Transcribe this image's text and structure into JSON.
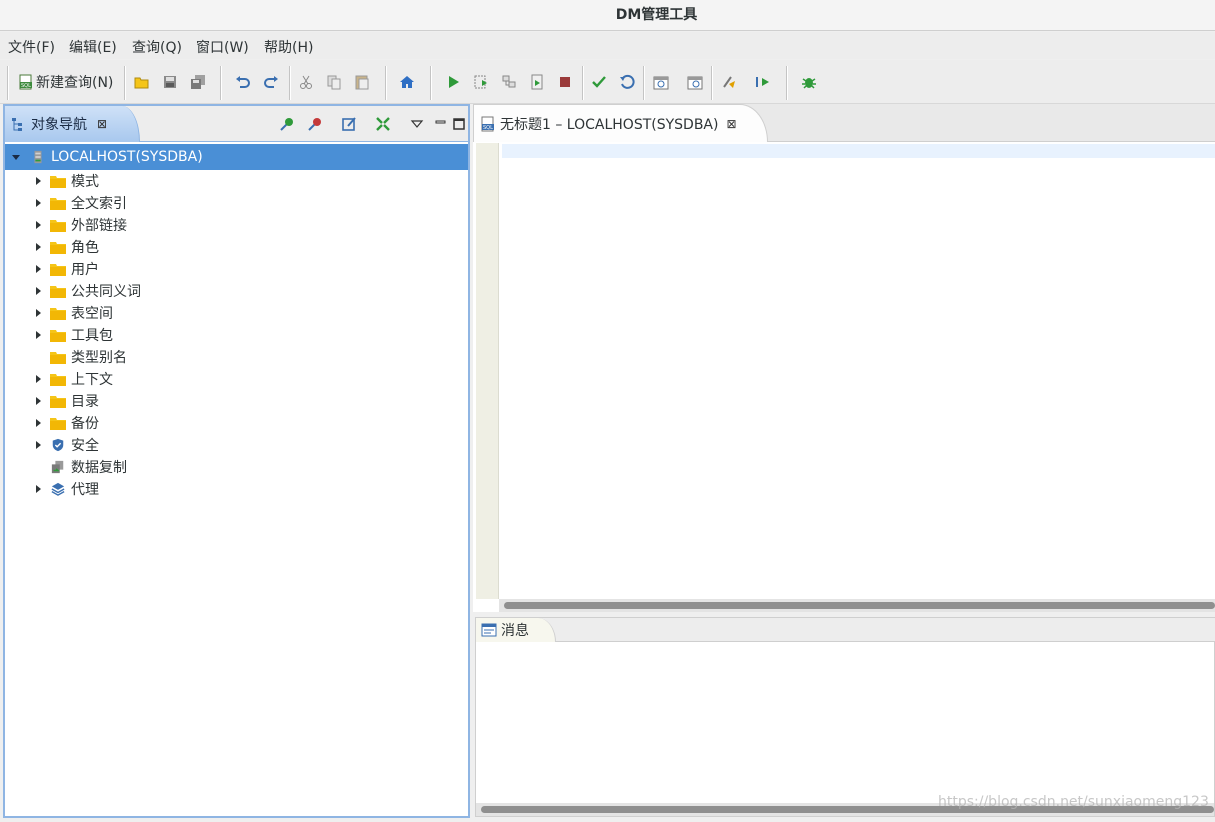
{
  "window": {
    "title": "DM管理工具"
  },
  "menubar": {
    "items": [
      "文件(F)",
      "编辑(E)",
      "查询(Q)",
      "窗口(W)",
      "帮助(H)"
    ]
  },
  "toolbar": {
    "new_query_label": "新建查询(N)",
    "icons": [
      "open-icon",
      "save-icon",
      "save-all-icon",
      "undo-icon",
      "redo-icon",
      "cut-icon",
      "copy-icon",
      "paste-icon",
      "home-icon",
      "run-icon",
      "run-selection-icon",
      "explain-icon",
      "run-script-icon",
      "stop-icon",
      "commit-icon",
      "rollback-icon",
      "schedule-icon",
      "schedule-alt-icon",
      "format-icon",
      "step-icon",
      "debug-icon"
    ]
  },
  "navigator": {
    "tab_label": "对象导航",
    "close_glyph": "⊠",
    "root": "LOCALHOST(SYSDBA)",
    "items": [
      {
        "label": "模式",
        "expandable": true,
        "icon": "folder-icon"
      },
      {
        "label": "全文索引",
        "expandable": true,
        "icon": "folder-icon"
      },
      {
        "label": "外部链接",
        "expandable": true,
        "icon": "folder-icon"
      },
      {
        "label": "角色",
        "expandable": true,
        "icon": "folder-icon"
      },
      {
        "label": "用户",
        "expandable": true,
        "icon": "folder-icon"
      },
      {
        "label": "公共同义词",
        "expandable": true,
        "icon": "folder-icon"
      },
      {
        "label": "表空间",
        "expandable": true,
        "icon": "folder-icon"
      },
      {
        "label": "工具包",
        "expandable": true,
        "icon": "folder-icon"
      },
      {
        "label": "类型别名",
        "expandable": false,
        "icon": "folder-icon"
      },
      {
        "label": "上下文",
        "expandable": true,
        "icon": "folder-icon"
      },
      {
        "label": "目录",
        "expandable": true,
        "icon": "folder-icon"
      },
      {
        "label": "备份",
        "expandable": true,
        "icon": "folder-icon"
      },
      {
        "label": "安全",
        "expandable": true,
        "icon": "shield-icon"
      },
      {
        "label": "数据复制",
        "expandable": false,
        "icon": "replication-icon"
      },
      {
        "label": "代理",
        "expandable": true,
        "icon": "layers-icon"
      }
    ]
  },
  "editor": {
    "tab_label": "无标题1 – LOCALHOST(SYSDBA)",
    "close_glyph": "⊠"
  },
  "messages": {
    "tab_label": "消息"
  },
  "watermark": "https://blog.csdn.net/sunxiaomeng123",
  "colors": {
    "selection": "#4a8fd6",
    "panel_border": "#8fb5e3",
    "folder": "#f5c518"
  }
}
